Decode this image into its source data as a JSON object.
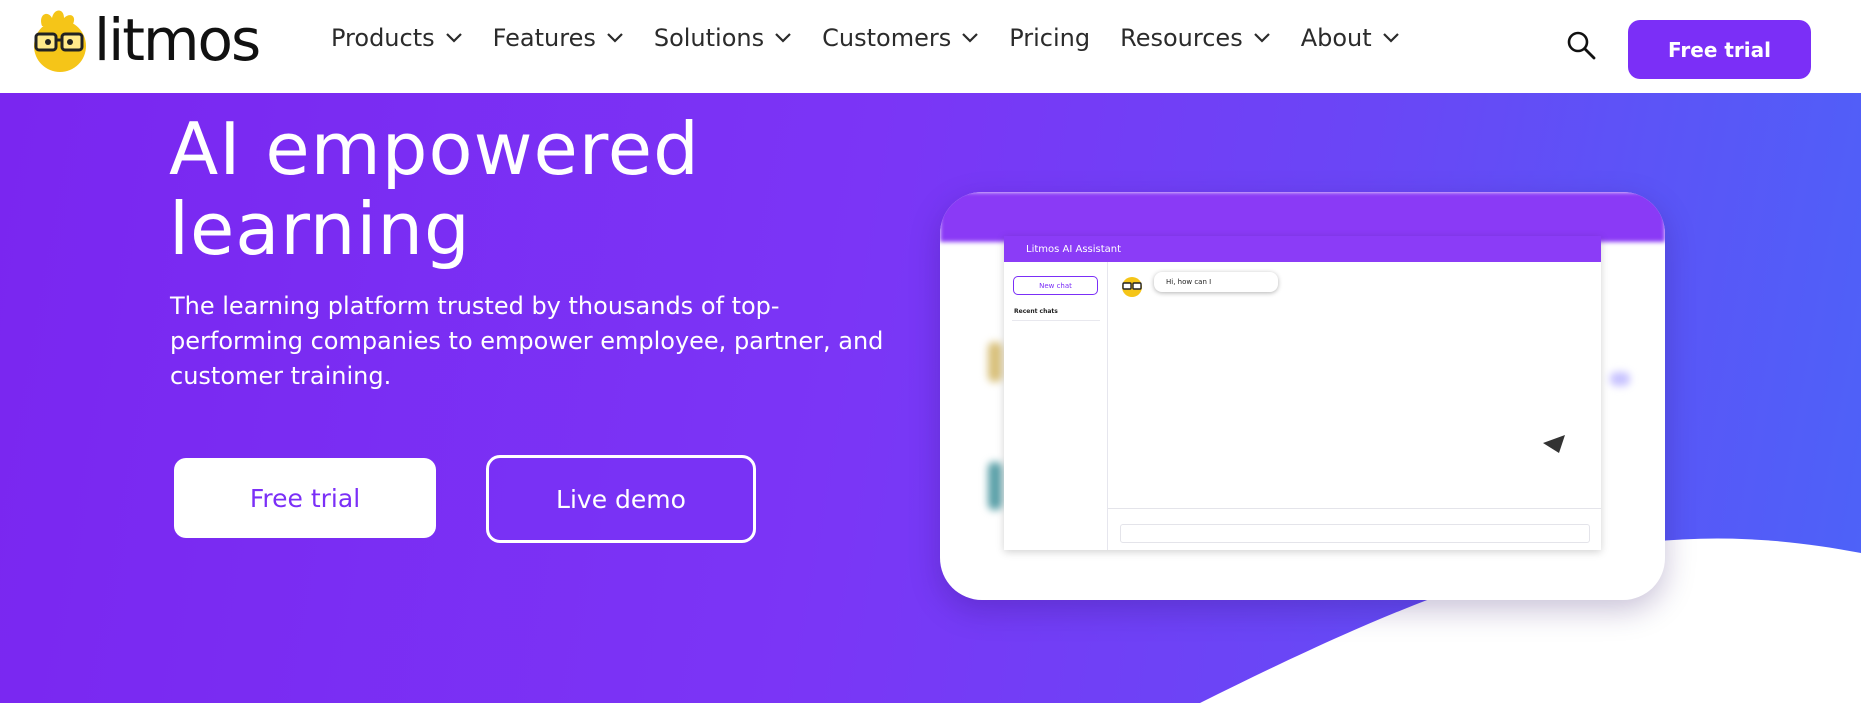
{
  "brand": {
    "name": "litmos"
  },
  "nav": {
    "items": [
      {
        "label": "Products",
        "dropdown": true
      },
      {
        "label": "Features",
        "dropdown": true
      },
      {
        "label": "Solutions",
        "dropdown": true
      },
      {
        "label": "Customers",
        "dropdown": true
      },
      {
        "label": "Pricing",
        "dropdown": false
      },
      {
        "label": "Resources",
        "dropdown": true
      },
      {
        "label": "About",
        "dropdown": true
      }
    ],
    "search_icon": "search-icon",
    "cta_label": "Free trial"
  },
  "hero": {
    "title_line1": "AI empowered",
    "title_line2": "learning",
    "subtitle": "The learning platform trusted by thousands of top-performing companies to empower employee, partner, and customer training.",
    "primary_cta": "Free trial",
    "secondary_cta": "Live demo"
  },
  "preview": {
    "window_title": "Litmos AI Assistant",
    "new_chat_label": "New chat",
    "recent_label": "Recent chats",
    "bubble_text": "Hi, how can I"
  },
  "colors": {
    "accent": "#7b2ff7",
    "hero_gradient_start": "#7a26f0",
    "hero_gradient_end": "#4c63f8",
    "logo_yellow": "#f5c518"
  }
}
